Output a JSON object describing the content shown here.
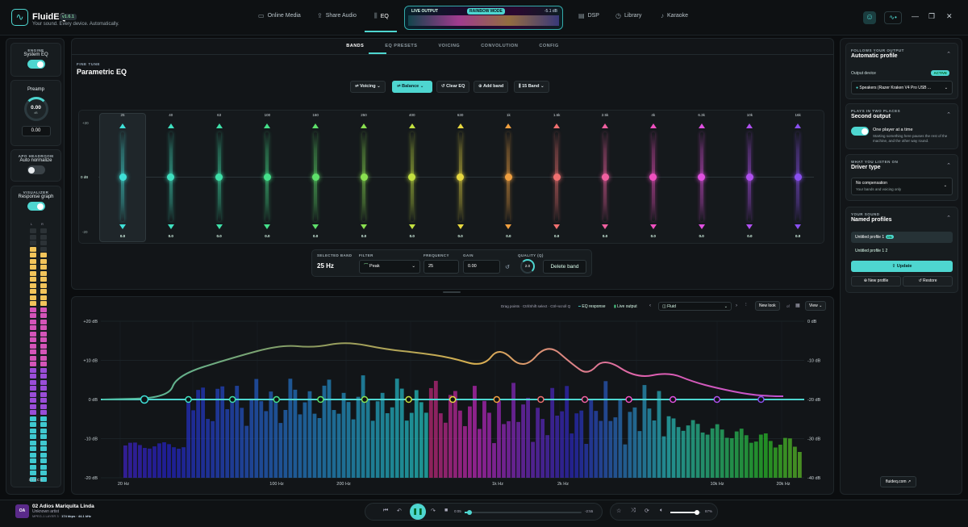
{
  "app": {
    "name": "FluidEQ",
    "version": "v1.6.1",
    "tagline": "Your sound. Every device. Automatically."
  },
  "nav": [
    {
      "label": "Online Media",
      "icon": "media-icon"
    },
    {
      "label": "Share Audio",
      "icon": "share-icon"
    },
    {
      "label": "EQ",
      "icon": "eq-icon",
      "active": true
    },
    {
      "label": "DSP",
      "icon": "dsp-icon"
    },
    {
      "label": "Library",
      "icon": "library-icon"
    },
    {
      "label": "Karaoke",
      "icon": "mic-icon"
    }
  ],
  "live_output": {
    "label": "LIVE OUTPUT",
    "mode": "RAINBOW MODE",
    "level": "-5.1 dB"
  },
  "window_controls": [
    "—",
    "❐",
    "✕"
  ],
  "sidebar": {
    "engine": {
      "caps": "ENGINE",
      "label": "System EQ",
      "on": true
    },
    "preamp": {
      "label": "Preamp",
      "knob_value": "0.00",
      "knob_unit": "dB",
      "value": "0.00"
    },
    "apo": {
      "caps": "APO HEADROOM",
      "label": "Auto normalize",
      "on": false
    },
    "visualizer": {
      "caps": "VISUALIZER",
      "label": "Response graph",
      "on": true,
      "left": "L",
      "right": "R",
      "footer": "STACK"
    }
  },
  "tabs": [
    "BANDS",
    "EQ PRESETS",
    "VOICING",
    "CONVOLUTION",
    "CONFIG"
  ],
  "eq": {
    "section": "FINE TUNE",
    "title": "Parametric EQ",
    "toolbar": {
      "voicing": "Voicing",
      "balance": "Balance",
      "clear": "Clear EQ",
      "add": "Add band",
      "bands": "15 Band"
    },
    "axis": {
      "top": "+20",
      "mid": "0 dB",
      "bottom": "-20"
    },
    "bands": [
      {
        "freq": "25",
        "value": "0.0",
        "color": "#3fe0d8"
      },
      {
        "freq": "40",
        "value": "0.0",
        "color": "#3fe0c0"
      },
      {
        "freq": "63",
        "value": "0.0",
        "color": "#3fe0a8"
      },
      {
        "freq": "100",
        "value": "0.0",
        "color": "#45e08a"
      },
      {
        "freq": "160",
        "value": "0.0",
        "color": "#5ee06a"
      },
      {
        "freq": "250",
        "value": "0.0",
        "color": "#8ae050"
      },
      {
        "freq": "400",
        "value": "0.0",
        "color": "#c3e040"
      },
      {
        "freq": "630",
        "value": "0.0",
        "color": "#e8d840"
      },
      {
        "freq": "1k",
        "value": "0.0",
        "color": "#f0a040"
      },
      {
        "freq": "1.6k",
        "value": "0.0",
        "color": "#f07070"
      },
      {
        "freq": "2.5k",
        "value": "0.0",
        "color": "#f060a0"
      },
      {
        "freq": "4k",
        "value": "0.0",
        "color": "#f050c0"
      },
      {
        "freq": "6.3k",
        "value": "0.0",
        "color": "#e050e0"
      },
      {
        "freq": "10k",
        "value": "0.0",
        "color": "#b050f0"
      },
      {
        "freq": "16k",
        "value": "0.0",
        "color": "#8a50f0"
      }
    ],
    "selected": {
      "caps": "SELECTED BAND",
      "value": "25 Hz",
      "filter_label": "FILTER",
      "filter": "Peak",
      "freq_label": "FREQUENCY",
      "freq": "25",
      "gain_label": "GAIN",
      "gain": "0.00",
      "q_label": "QUALITY (Q)",
      "q": "2.0",
      "delete": "Delete band"
    }
  },
  "graph": {
    "hint": "Drag points · Ctrl/Shift select · Ctrl+scroll Q",
    "legend_eq": "EQ response",
    "legend_live": "Live output",
    "preset": "Fluid",
    "new_look": "New look",
    "of": "of",
    "view": "View",
    "left_axis": [
      "+20 dB",
      "+10 dB",
      "0 dB",
      "-10 dB",
      "-20 dB"
    ],
    "right_axis": [
      "0 dB",
      "-10 dB",
      "-20 dB",
      "-30 dB",
      "-40 dB"
    ],
    "x_labels": [
      "20 Hz",
      "100 Hz",
      "200 Hz",
      "1k Hz",
      "2k Hz",
      "10k Hz",
      "20k Hz"
    ]
  },
  "right": {
    "output": {
      "caps": "FOLLOWS YOUR OUTPUT",
      "title": "Automatic profile",
      "label": "Output device",
      "badge": "ACTIVE",
      "device": "Speakers (Razer Kraken V4 Pro USB ..."
    },
    "second": {
      "caps": "PLAYS IN TWO PLACES",
      "title": "Second output",
      "opt": "One player at a time",
      "desc": "Starting something here pauses the rest of the machine, and the other way round."
    },
    "driver": {
      "caps": "WHAT YOU LISTEN ON",
      "title": "Driver type",
      "sel": "No compensation",
      "sel_sub": "Your bands and voicing only"
    },
    "profiles": {
      "caps": "YOUR SOUND",
      "title": "Named profiles",
      "items": [
        "Untitled profile 1",
        "Untitled profile 1 2"
      ],
      "on": "ON",
      "update": "Update",
      "new": "New profile",
      "restore": "Restore"
    },
    "site": "fluideq.com"
  },
  "player": {
    "art": "OA",
    "title": "02 Adios Mariquita Linda",
    "artist": "Unknown artist",
    "meta": "MPEG-1 LAYER 3 · ",
    "bitrate": "174 kbps · 44.1 kHz",
    "elapsed": "0:05",
    "remaining": "-2:55",
    "progress": 0.04,
    "volume": "87%",
    "volume_level": 0.87
  },
  "colors": {
    "accent": "#4ed6d0"
  }
}
